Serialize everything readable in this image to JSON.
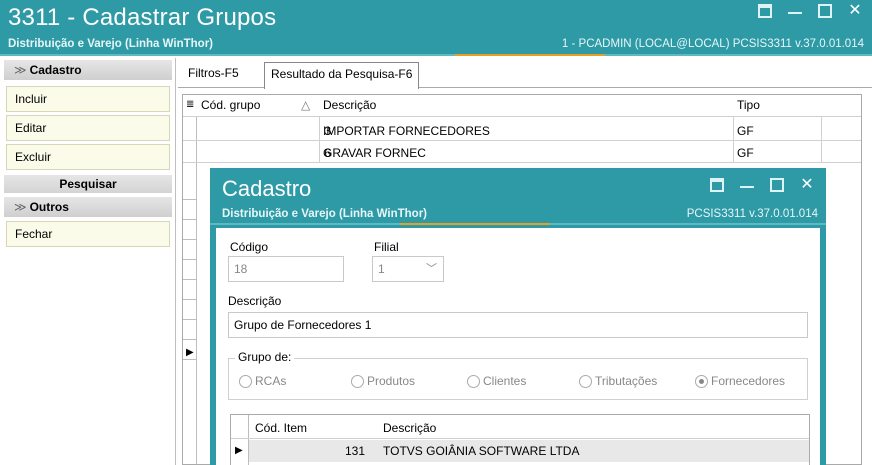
{
  "window": {
    "title": "3311 - Cadastrar Grupos",
    "subtitle": "Distribuição e Varejo (Linha WinThor)",
    "info": "1 - PCADMIN (LOCAL@LOCAL)   PCSIS3311  v.37.0.01.014"
  },
  "sidebar": {
    "cadastro_header": "Cadastro",
    "items": [
      "Incluir",
      "Editar",
      "Excluir"
    ],
    "pesquisar": "Pesquisar",
    "outros_header": "Outros",
    "outros_items": [
      "Fechar"
    ]
  },
  "tabs": [
    "Filtros-F5",
    "Resultado da Pesquisa-F6"
  ],
  "grid": {
    "columns": [
      "Cód. grupo",
      "Descrição",
      "Tipo"
    ],
    "rows": [
      {
        "codigo": "3",
        "descricao": "IMPORTAR FORNECEDORES",
        "tipo": "GF"
      },
      {
        "codigo": "6",
        "descricao": "GRAVAR FORNEC",
        "tipo": "GF"
      }
    ]
  },
  "dialog": {
    "title": "Cadastro",
    "subtitle": "Distribuição e Varejo (Linha WinThor)",
    "info": "PCSIS3311  v.37.0.01.014",
    "codigo_label": "Código",
    "codigo_value": "18",
    "filial_label": "Filial",
    "filial_value": "1",
    "descricao_label": "Descrição",
    "descricao_value": "Grupo  de Fornecedores 1",
    "grupo_label": "Grupo de:",
    "radios": [
      "RCAs",
      "Produtos",
      "Clientes",
      "Tributações",
      "Fornecedores"
    ],
    "selected_radio": "Fornecedores",
    "subgrid_columns": [
      "Cód. Item",
      "Descrição"
    ],
    "subgrid_row": {
      "codigo": "131",
      "descricao": "TOTVS GOIÂNIA SOFTWARE LTDA"
    }
  }
}
